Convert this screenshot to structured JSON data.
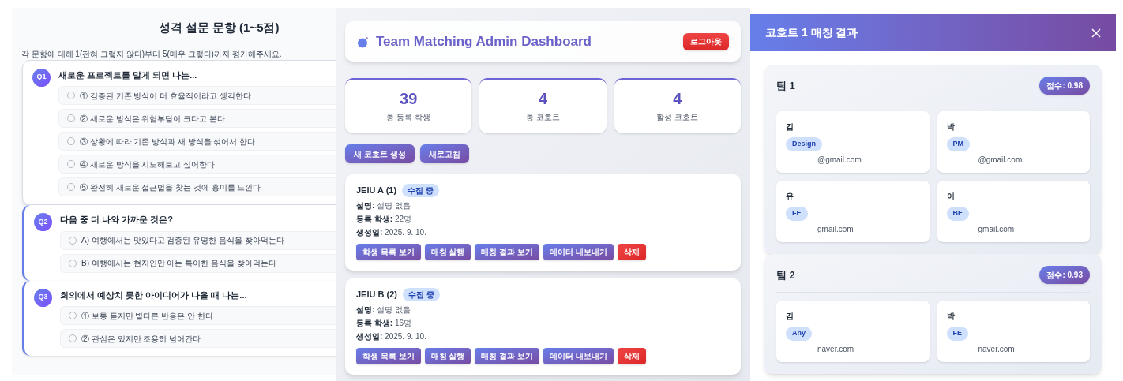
{
  "survey": {
    "title": "성격 설문 문항 (1~5점)",
    "instruction": "각 문항에 대해 1(전혀 그렇지 않다)부터 5(매우 그렇다)까지 평가해주세요.",
    "questions": [
      {
        "badge": "Q1",
        "text": "새로운 프로젝트를 맡게 되면 나는...",
        "active": true,
        "options": [
          {
            "text": "① 검증된 기존 방식이 더 효율적이라고 생각한다",
            "selected": false
          },
          {
            "text": "② 새로운 방식은 위험부담이 크다고 본다",
            "selected": false
          },
          {
            "text": "③ 상황에 따라 기존 방식과 새 방식을 섞어서 한다",
            "selected": false
          },
          {
            "text": "④ 새로운 방식을 시도해보고 싶어한다",
            "selected": false
          },
          {
            "text": "⑤ 완전히 새로운 접근법을 찾는 것에 흥미를 느낀다",
            "selected": false
          }
        ]
      },
      {
        "badge": "Q2",
        "text": "다음 중 더 나와 가까운 것은?",
        "active": false,
        "options": [
          {
            "text": "A) 여행에서는 맛있다고 검증된 유명한 음식을 찾아먹는다",
            "selected": false
          },
          {
            "text": "B) 여행에서는 현지인만 아는 특이한 음식을 찾아먹는다",
            "selected": false
          }
        ]
      },
      {
        "badge": "Q3",
        "text": "회의에서 예상치 못한 아이디어가 나올 때 나는...",
        "active": false,
        "options": [
          {
            "text": "① 보통 듣지만 별다른 반응은 안 한다",
            "selected": false
          },
          {
            "text": "② 관심은 있지만 조용히 넘어간다",
            "selected": false
          }
        ]
      }
    ]
  },
  "dashboard": {
    "title": "Team Matching Admin Dashboard",
    "logout": "로그아웃",
    "stats": [
      {
        "value": "39",
        "label": "총 등록 학생"
      },
      {
        "value": "4",
        "label": "총 코호트"
      },
      {
        "value": "4",
        "label": "활성 코호트"
      }
    ],
    "actions": [
      "새 코호트 생성",
      "새로고침"
    ],
    "cohorts": [
      {
        "name": "JEIU A (1)",
        "status": "수집 중",
        "fields": [
          {
            "label": "설명:",
            "value": "설명 없음"
          },
          {
            "label": "등록 학생:",
            "value": "22명"
          },
          {
            "label": "생성일:",
            "value": "2025. 9. 10."
          }
        ],
        "buttons": [
          {
            "label": "학생 목록 보기",
            "kind": "primary"
          },
          {
            "label": "매칭 실행",
            "kind": "primary"
          },
          {
            "label": "매칭 결과 보기",
            "kind": "primary"
          },
          {
            "label": "데이터 내보내기",
            "kind": "primary"
          },
          {
            "label": "삭제",
            "kind": "danger"
          }
        ]
      },
      {
        "name": "JEIU B (2)",
        "status": "수집 중",
        "fields": [
          {
            "label": "설명:",
            "value": "설명 없음"
          },
          {
            "label": "등록 학생:",
            "value": "16명"
          },
          {
            "label": "생성일:",
            "value": "2025. 9. 10."
          }
        ],
        "buttons": [
          {
            "label": "학생 목록 보기",
            "kind": "primary"
          },
          {
            "label": "매칭 실행",
            "kind": "primary"
          },
          {
            "label": "매칭 결과 보기",
            "kind": "primary"
          },
          {
            "label": "데이터 내보내기",
            "kind": "primary"
          },
          {
            "label": "삭제",
            "kind": "danger"
          }
        ]
      }
    ]
  },
  "modal": {
    "title": "코호트 1 매칭 결과",
    "teams": [
      {
        "name": "팀 1",
        "score": "점수: 0.98",
        "members": [
          {
            "name": "김",
            "role": "Design",
            "email": "@gmail.com"
          },
          {
            "name": "박",
            "role": "PM",
            "email": "@gmail.com"
          },
          {
            "name": "유",
            "role": "FE",
            "email": "gmail.com"
          },
          {
            "name": "이",
            "role": "BE",
            "email": "gmail.com"
          }
        ]
      },
      {
        "name": "팀 2",
        "score": "점수: 0.93",
        "members": [
          {
            "name": "김",
            "role": "Any",
            "email": "naver.com"
          },
          {
            "name": "박",
            "role": "FE",
            "email": "naver.com"
          }
        ]
      }
    ]
  }
}
